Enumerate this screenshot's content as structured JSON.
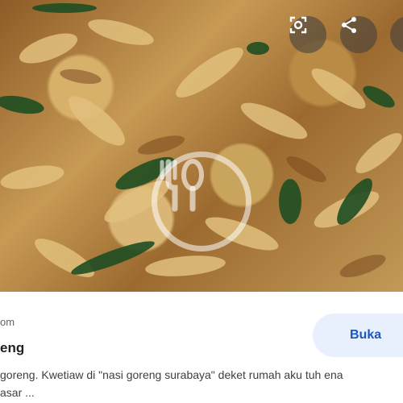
{
  "result": {
    "source_fragment": "om",
    "title_fragment": "eng",
    "description_line1": "goreng. Kwetiaw di \"nasi goreng surabaya\" deket rumah aku tuh ena",
    "description_line2": "asar ...",
    "open_button_label": "Buka"
  },
  "image": {
    "overlay_icons": [
      "lens-icon",
      "share-icon",
      "more-icon"
    ],
    "watermark": "food-watermark-logo"
  },
  "colors": {
    "button_bg": "#e8f0fe",
    "button_text": "#1a56c4",
    "overlay": "rgba(60,60,60,0.55)"
  }
}
